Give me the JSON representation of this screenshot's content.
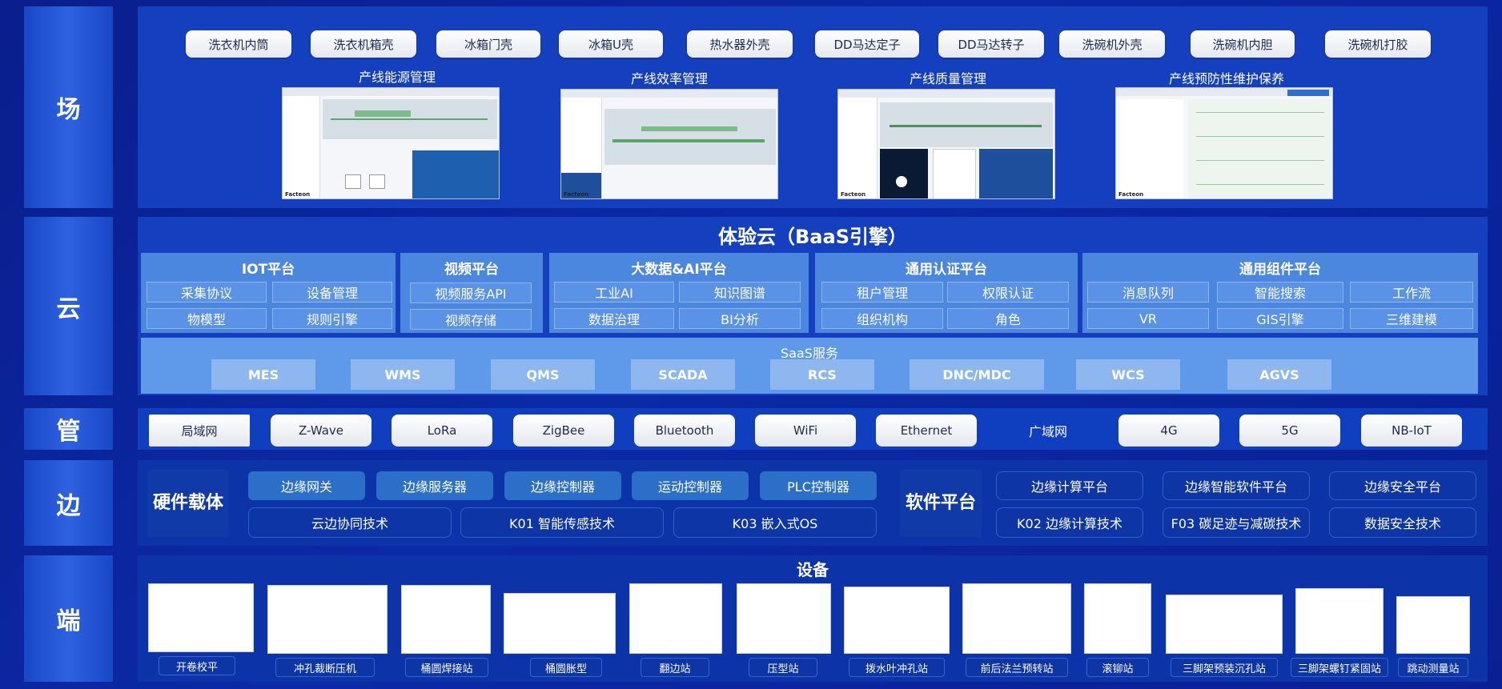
{
  "layers": {
    "chang": "场",
    "yun": "云",
    "guan": "管",
    "bian": "边",
    "duan": "端"
  },
  "products": [
    "洗衣机内筒",
    "洗衣机箱壳",
    "冰箱门壳",
    "冰箱U壳",
    "热水器外壳",
    "DD马达定子",
    "DD马达转子",
    "洗碗机外壳",
    "洗碗机内胆",
    "洗碗机打胶"
  ],
  "apps": [
    {
      "title": "产线能源管理",
      "brand": "Facteon"
    },
    {
      "title": "产线效率管理",
      "brand": "Facteon"
    },
    {
      "title": "产线质量管理",
      "brand": "Facteon"
    },
    {
      "title": "产线预防性维护保养",
      "brand": "Facteon"
    }
  ],
  "cloud": {
    "title": "体验云（BaaS引擎）",
    "groups": [
      {
        "title": "IOT平台",
        "items": [
          "采集协议",
          "设备管理",
          "物模型",
          "规则引擎"
        ]
      },
      {
        "title": "视频平台",
        "items": [
          "视频服务API",
          "视频存储"
        ]
      },
      {
        "title": "大数据&AI平台",
        "items": [
          "工业AI",
          "知识图谱",
          "数据治理",
          "BI分析"
        ]
      },
      {
        "title": "通用认证平台",
        "items": [
          "租户管理",
          "权限认证",
          "组织机构",
          "角色"
        ]
      },
      {
        "title": "通用组件平台",
        "items": [
          "消息队列",
          "智能搜索",
          "工作流",
          "VR",
          "GIS引擎",
          "三维建模"
        ]
      }
    ],
    "saas": {
      "title": "SaaS服务",
      "items": [
        "MES",
        "WMS",
        "QMS",
        "SCADA",
        "RCS",
        "DNC/MDC",
        "WCS",
        "AGVS"
      ]
    }
  },
  "network": {
    "lan_label": "局域网",
    "lan": [
      "Z-Wave",
      "LoRa",
      "ZigBee",
      "Bluetooth",
      "WiFi",
      "Ethernet"
    ],
    "wan_label": "广域网",
    "wan": [
      "4G",
      "5G",
      "NB-IoT"
    ]
  },
  "edge": {
    "hardware_label": "硬件载体",
    "hardware_items": [
      "边缘网关",
      "边缘服务器",
      "边缘控制器",
      "运动控制器",
      "PLC控制器"
    ],
    "hardware_tech": [
      "云边协同技术",
      "K01 智能传感技术",
      "K03 嵌入式OS"
    ],
    "software_label": "软件平台",
    "software_items": [
      "边缘计算平台",
      "边缘智能软件平台",
      "边缘安全平台"
    ],
    "software_tech": [
      "K02 边缘计算技术",
      "F03 碳足迹与减碳技术",
      "数据安全技术"
    ]
  },
  "devices": {
    "title": "设备",
    "items": [
      "开卷校平",
      "冲孔裁断压机",
      "桶圆焊接站",
      "桶圆胀型",
      "翻边站",
      "压型站",
      "拨水叶冲孔站",
      "前后法兰预转站",
      "滚铆站",
      "三脚架预装沉孔站",
      "三脚架螺钉紧固站",
      "跳动测量站"
    ]
  }
}
